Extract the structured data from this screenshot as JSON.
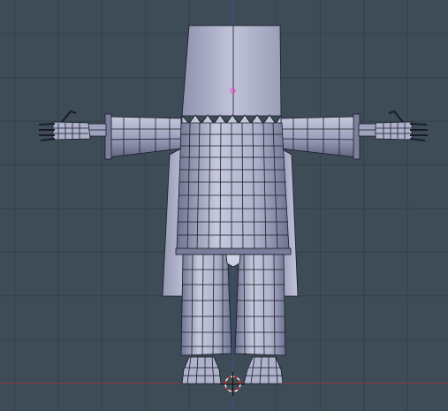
{
  "viewport": {
    "background": "#3d4c57",
    "grid_color": "#33404a",
    "x_axis_color": "#8a3a3a",
    "y_axis_color": "#3a4e86",
    "mesh_face_color": "#aaaec8",
    "mesh_face_light": "#c6c9dc",
    "mesh_face_dark": "#6d7290",
    "wire_color": "#1a1c28",
    "origin_color": "#ff4fd8",
    "cursor_color_a": "#e03030",
    "cursor_color_b": "#ffffff",
    "cursor_icon": "3d-cursor-icon",
    "object_origin_icon": "object-origin-icon"
  }
}
